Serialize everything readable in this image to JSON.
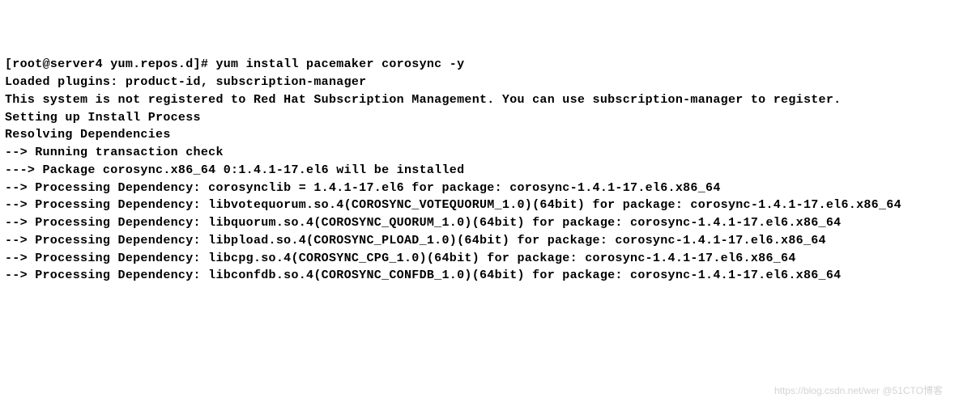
{
  "terminal": {
    "lines": [
      "[root@server4 yum.repos.d]# yum install pacemaker corosync -y",
      "Loaded plugins: product-id, subscription-manager",
      "This system is not registered to Red Hat Subscription Management. You can use subscription-manager to register.",
      "Setting up Install Process",
      "Resolving Dependencies",
      "--> Running transaction check",
      "---> Package corosync.x86_64 0:1.4.1-17.el6 will be installed",
      "--> Processing Dependency: corosynclib = 1.4.1-17.el6 for package: corosync-1.4.1-17.el6.x86_64",
      "--> Processing Dependency: libvotequorum.so.4(COROSYNC_VOTEQUORUM_1.0)(64bit) for package: corosync-1.4.1-17.el6.x86_64",
      "--> Processing Dependency: libquorum.so.4(COROSYNC_QUORUM_1.0)(64bit) for package: corosync-1.4.1-17.el6.x86_64",
      "--> Processing Dependency: libpload.so.4(COROSYNC_PLOAD_1.0)(64bit) for package: corosync-1.4.1-17.el6.x86_64",
      "--> Processing Dependency: libcpg.so.4(COROSYNC_CPG_1.0)(64bit) for package: corosync-1.4.1-17.el6.x86_64",
      "--> Processing Dependency: libconfdb.so.4(COROSYNC_CONFDB_1.0)(64bit) for package: corosync-1.4.1-17.el6.x86_64"
    ]
  },
  "watermark": "https://blog.csdn.net/wer @51CTO博客"
}
